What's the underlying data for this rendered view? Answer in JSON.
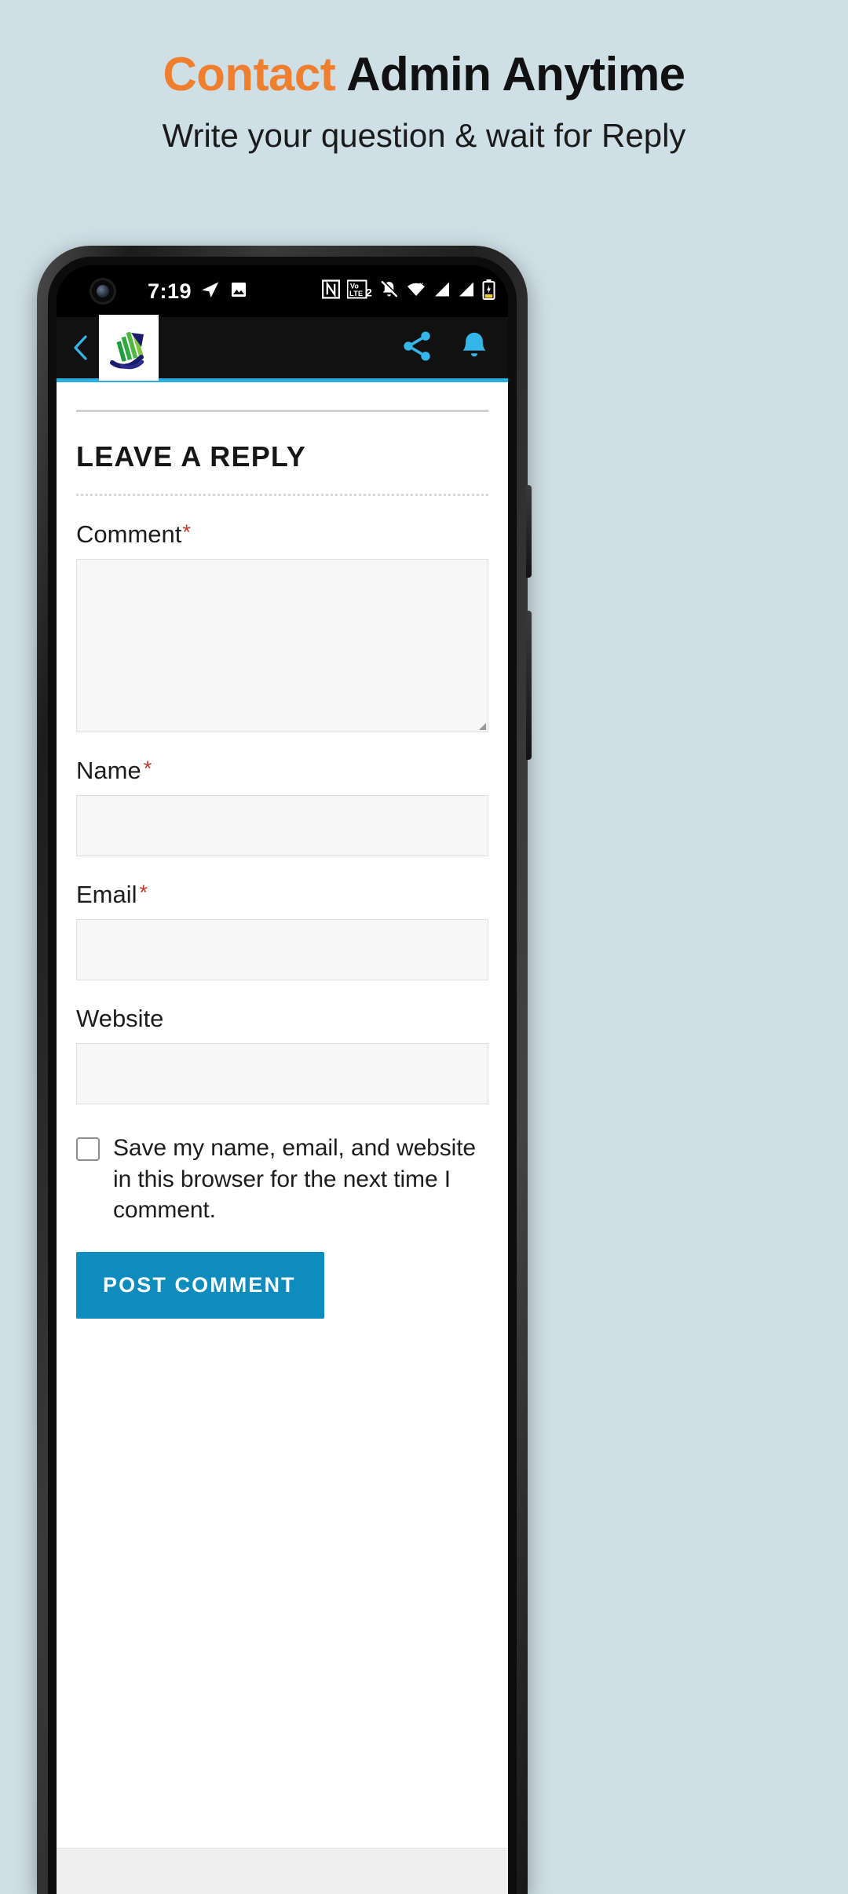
{
  "promo": {
    "title_accent": "Contact",
    "title_rest": " Admin Anytime",
    "subtitle": "Write your question & wait for Reply",
    "accent_color": "#ef7f2f",
    "background_color": "#cfdfe6"
  },
  "status_bar": {
    "time": "7:19",
    "left_icons": [
      "telegram-icon",
      "image-icon"
    ],
    "right_icons": [
      "nfc-icon",
      "volte2-icon",
      "mute-icon",
      "wifi-icon",
      "signal-one-icon",
      "signal-two-icon",
      "battery-icon"
    ],
    "volte_label_top": "Vo",
    "volte_label_bottom": "LTE",
    "volte_sim": "2"
  },
  "app_bar": {
    "back_icon": "chevron-left-icon",
    "logo_icon": "app-logo-icon",
    "share_icon": "share-icon",
    "notification_icon": "bell-icon",
    "icon_color": "#35b6e8",
    "accent_rule_color": "#2aaee0"
  },
  "form": {
    "heading": "LEAVE A REPLY",
    "comment": {
      "label": "Comment",
      "required_mark": "*",
      "value": "",
      "placeholder": ""
    },
    "name": {
      "label": "Name",
      "required_mark": "*",
      "value": "",
      "placeholder": ""
    },
    "email": {
      "label": "Email",
      "required_mark": "*",
      "value": "",
      "placeholder": ""
    },
    "website": {
      "label": "Website",
      "required_mark": "",
      "value": "",
      "placeholder": ""
    },
    "consent": {
      "label": "Save my name, email, and website in this browser for the next time I comment.",
      "checked": false
    },
    "submit_label": "Post Comment",
    "submit_color": "#0e8cbe"
  }
}
